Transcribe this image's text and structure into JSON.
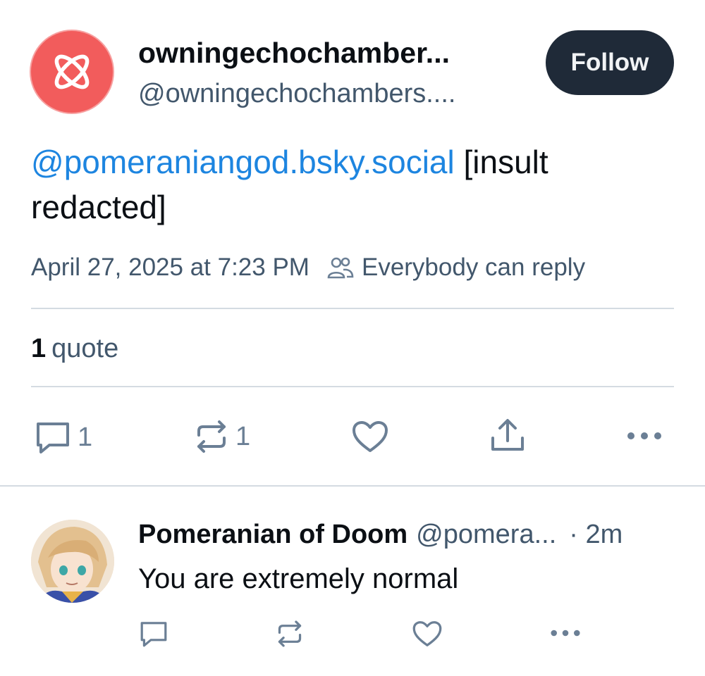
{
  "post": {
    "author": {
      "display_name": "owningechochamber...",
      "handle": "@owningechochambers...."
    },
    "follow_label": "Follow",
    "mention": "@pomeraniangod.bsky.social",
    "text_after_mention": "[insult redacted]",
    "timestamp": "April 27, 2025 at 7:23 PM",
    "audience": "Everybody can reply",
    "quote_count": "1",
    "quote_label": "quote",
    "actions": {
      "reply_count": "1",
      "repost_count": "1"
    }
  },
  "reply": {
    "display_name": "Pomeranian of Doom",
    "handle": "@pomera...",
    "time": "· 2m",
    "text": "You are extremely normal"
  },
  "colors": {
    "link": "#1d85e0",
    "follow_bg": "#1f2a38",
    "avatar_bg": "#f25c5c",
    "muted": "#42576c",
    "icon": "#6b7f95"
  }
}
